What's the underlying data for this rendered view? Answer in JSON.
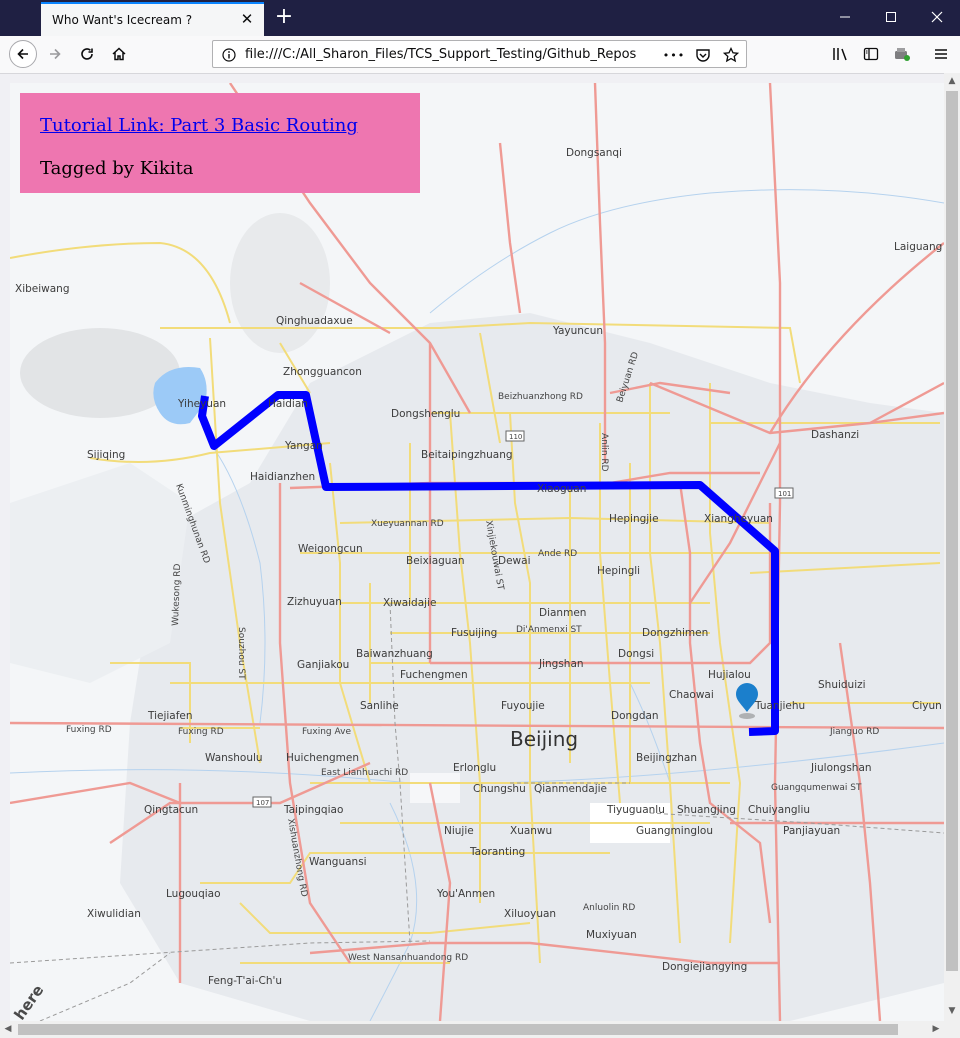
{
  "browser": {
    "tab_title": "Who Want's Icecream ?",
    "url": "file:///C:/All_Sharon_Files/TCS_Support_Testing/Github_Reposito",
    "page_actions_glyph": "•••"
  },
  "info_panel": {
    "link_text": "Tutorial Link: Part 3 Basic Routing",
    "tagline": "Tagged by Kikita",
    "background": "#ee76b0"
  },
  "map": {
    "city": "Beijing",
    "attribution": "here",
    "route_color": "#0000ff",
    "marker_color": "#1b7fcc",
    "places": [
      "Dongsanqi",
      "Laiguang",
      "Xibeiwang",
      "Qinghuadaxue",
      "Yayuncun",
      "Zhongguancon",
      "Yiheyuan",
      "Haidian",
      "Dongshenglu",
      "Dashanzi",
      "Sijiqing",
      "Yangan",
      "Beitaipingzhuang",
      "Haidianzhen",
      "Xiaoguan",
      "Hepingjie",
      "Xiangheyuan",
      "Weigongcun",
      "Beixiaguan",
      "Dewai",
      "Hepingli",
      "Zizhuyuan",
      "Xiwaidajie",
      "Dianmen",
      "Fusuijing",
      "Dongzhimen",
      "Ganjiakou",
      "Baiwanzhuang",
      "Dongsi",
      "Jingshan",
      "Hujialou",
      "Shuiduizi",
      "Fuchengmen",
      "Chaowai",
      "Sanlihe",
      "Fuyoujie",
      "Dongdan",
      "Tuanjiehu",
      "Ciyun",
      "Tiejiafen",
      "Wanshoulu",
      "Huichengmen",
      "Erlonglu",
      "Beijingzhan",
      "Jiulongshan",
      "Chungshu",
      "Qianmendajie",
      "Qingtacun",
      "Taipingqiao",
      "Tiyuguanlu",
      "Shuangjing",
      "Chuiyangliu",
      "Niujie",
      "Xuanwu",
      "Guangminglou",
      "Panjiayuan",
      "Taoranting",
      "Wanguansi",
      "Lugouqiao",
      "You'Anmen",
      "Xiwulidian",
      "Xiluoyuan",
      "Muxiyuan",
      "Dongiejiangying",
      "Feng-T'ai-Ch'u"
    ],
    "roads": [
      "Beizhuanzhong RD",
      "Beiyuan RD",
      "Anlin RD",
      "Xueyuannan RD",
      "Xinjiekouwai ST",
      "Ande RD",
      "Di'Anmenxi ST",
      "Kunminghunan RD",
      "Wukesong RD",
      "Souzhou ST",
      "Fuxing RD",
      "Fuxing RD",
      "Fuxing Ave",
      "Jianguo RD",
      "East Lianhuachi RD",
      "Guangqumenwai ST",
      "Xishuanzhong RD",
      "Anluolin RD",
      "West Nansanhuandong RD"
    ],
    "route_shields": [
      "110",
      "110",
      "101",
      "107"
    ]
  }
}
